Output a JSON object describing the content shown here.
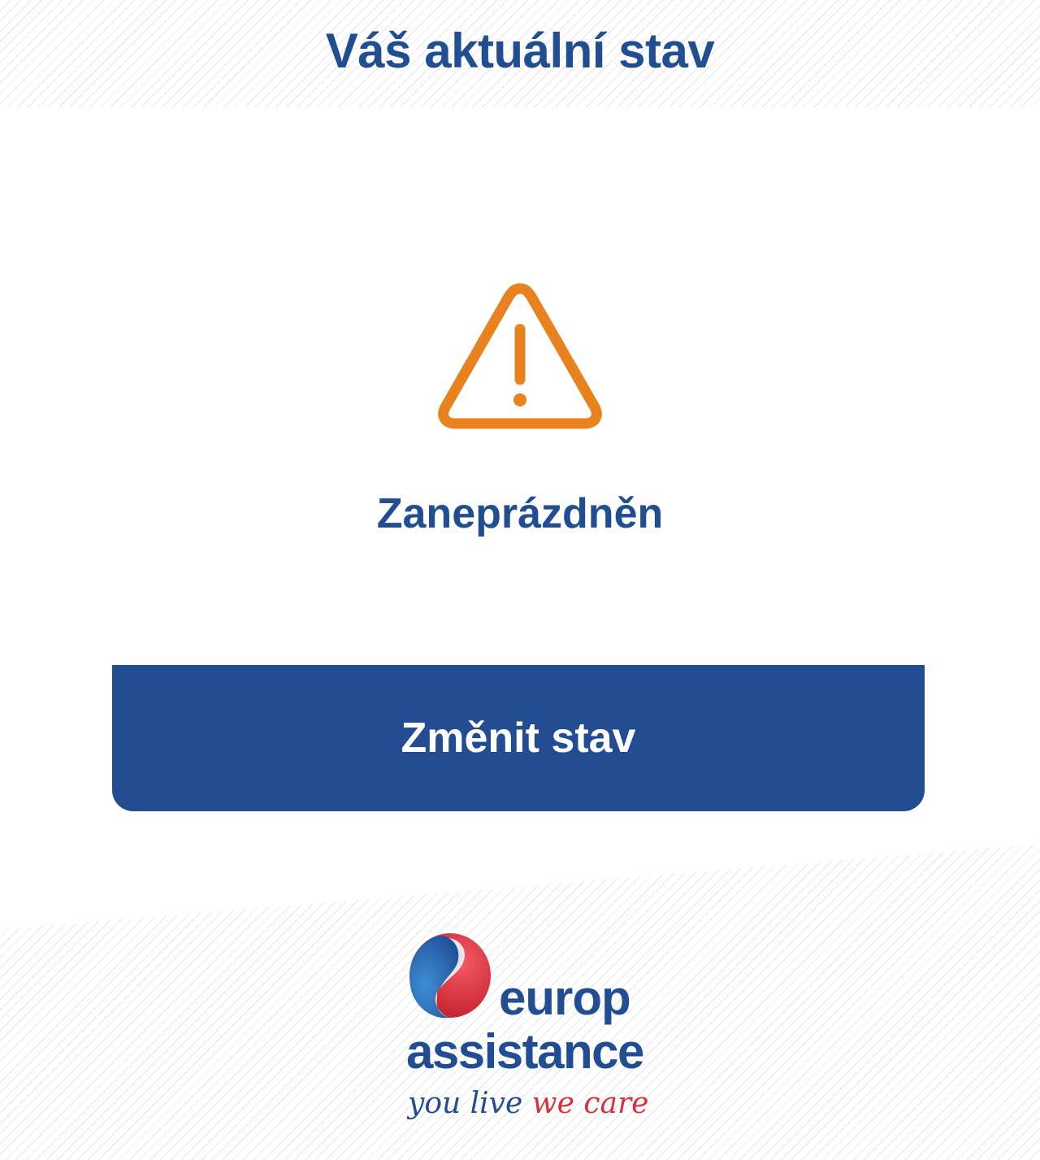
{
  "header": {
    "title": "Váš aktuální stav"
  },
  "status": {
    "icon": "warning-triangle-icon",
    "label": "Zaneprázdněn",
    "color": "#e8821e"
  },
  "actions": {
    "change_status_label": "Změnit stav"
  },
  "brand": {
    "name_line1": "europ",
    "name_line2": "assistance",
    "tagline_part1": "you live",
    "tagline_part2": "we care",
    "primary_color": "#214d92",
    "accent_color": "#d92f3a"
  }
}
